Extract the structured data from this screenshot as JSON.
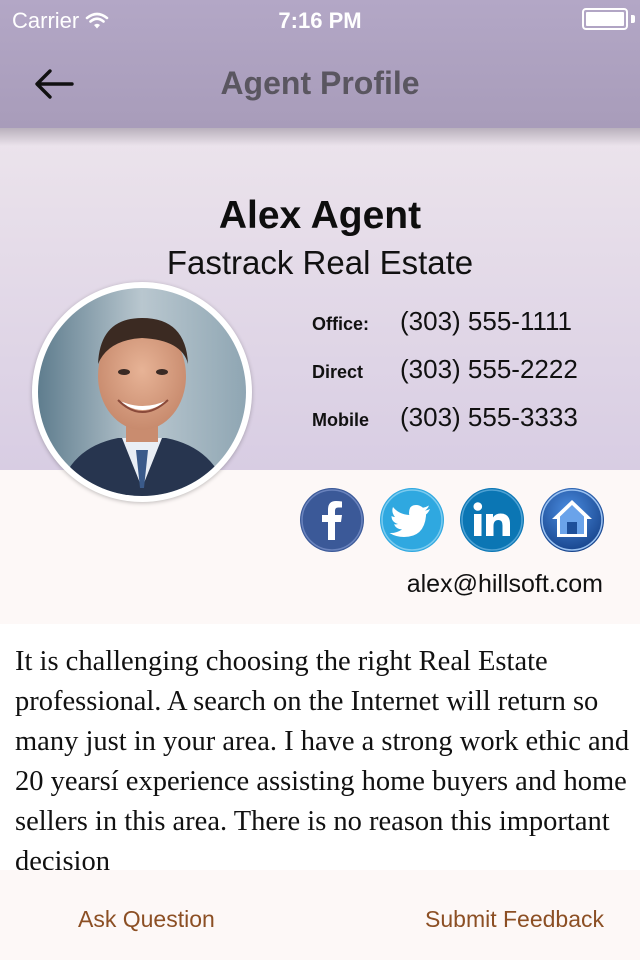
{
  "status_bar": {
    "carrier": "Carrier",
    "time": "7:16 PM"
  },
  "nav": {
    "title": "Agent Profile",
    "back_icon": "arrow-left-icon"
  },
  "agent": {
    "name": "Alex Agent",
    "company": "Fastrack Real Estate",
    "phones": [
      {
        "label": "Office:",
        "value": "(303) 555-1111"
      },
      {
        "label": "Direct",
        "value": "(303) 555-2222"
      },
      {
        "label": "Mobile",
        "value": "(303) 555-3333"
      }
    ],
    "email": "alex@hillsoft.com",
    "social": [
      {
        "icon": "facebook-icon",
        "color": "#3b5998"
      },
      {
        "icon": "twitter-icon",
        "color": "#2fa8e0"
      },
      {
        "icon": "linkedin-icon",
        "color": "#0b76b4"
      },
      {
        "icon": "home-icon",
        "color": "#1d5cab"
      }
    ],
    "bio": "It is challenging choosing the right Real Estate professional. A search on the Internet will return so many just in your area. I have a strong work ethic and 20 yearsí experience assisting home buyers and home sellers in this area. There is no reason this important decision"
  },
  "bottom_bar": {
    "ask_label": "Ask Question",
    "feedback_label": "Submit Feedback"
  },
  "colors": {
    "nav_bar": "#aa9ebd",
    "header": "#ddd3e6",
    "accent_link": "#8c4f24"
  }
}
